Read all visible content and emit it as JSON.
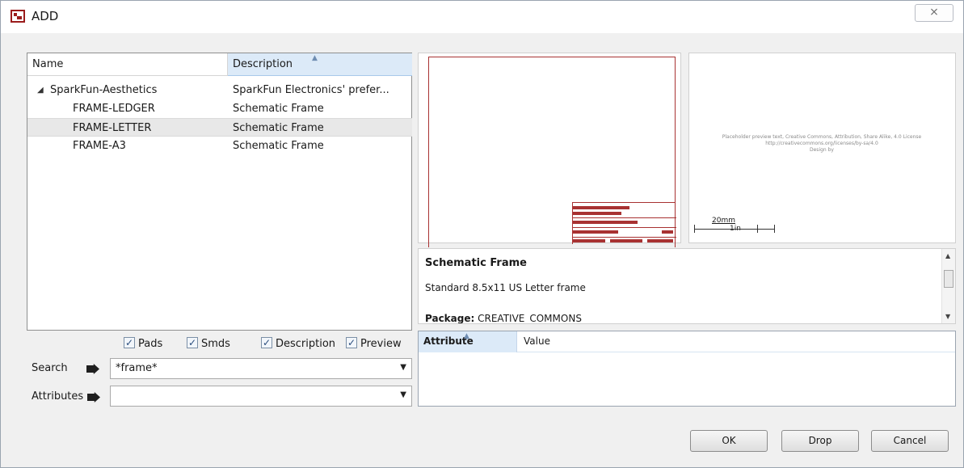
{
  "window": {
    "title": "ADD",
    "close_glyph": "⨯"
  },
  "tree": {
    "columns": {
      "name": "Name",
      "description": "Description"
    },
    "expand_glyph": "◢",
    "rows": [
      {
        "name": "SparkFun-Aesthetics",
        "description": "SparkFun Electronics' prefer..."
      },
      {
        "name": "FRAME-LEDGER",
        "description": "Schematic Frame"
      },
      {
        "name": "FRAME-LETTER",
        "description": "Schematic Frame"
      },
      {
        "name": "FRAME-A3",
        "description": "Schematic Frame"
      }
    ]
  },
  "options": {
    "pads": "Pads",
    "smds": "Smds",
    "description": "Description",
    "preview": "Preview"
  },
  "search": {
    "label": "Search",
    "value": "*frame*"
  },
  "attributes": {
    "label": "Attributes",
    "value": ""
  },
  "preview_right": {
    "tiny_text_1": "Placeholder preview text, Creative Commons, Attribution, Share Alike, 4.0 License",
    "tiny_text_2": "http://creativecommons.org/licenses/by-sa/4.0",
    "tiny_text_3": "Design by",
    "scale_20mm": "20mm",
    "scale_1in": "1in"
  },
  "details": {
    "title": "Schematic Frame",
    "subtitle": "Standard 8.5x11 US Letter frame",
    "package_label": "Package:",
    "package_value": "CREATIVE_COMMONS"
  },
  "attribute_table": {
    "col_attribute": "Attribute",
    "col_value": "Value"
  },
  "buttons": {
    "ok": "OK",
    "drop": "Drop",
    "cancel": "Cancel"
  },
  "colors": {
    "frame_red": "#a83232",
    "header_blue": "#dceaf8"
  }
}
